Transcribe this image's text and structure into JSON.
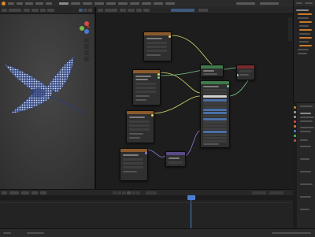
{
  "app": {
    "name": "",
    "scene": "",
    "view_layer": ""
  },
  "topbar": {
    "menus": [
      "",
      "",
      "",
      "",
      "",
      "",
      "",
      "",
      "",
      ""
    ],
    "workspace_tabs": [
      "",
      "",
      "",
      ""
    ]
  },
  "viewport": {
    "mode": "",
    "header_items": [
      "",
      "",
      "",
      ""
    ]
  },
  "node_editor": {
    "material": "",
    "header_items": [
      "",
      "",
      "",
      "",
      ""
    ],
    "nodes": [
      {
        "title": "",
        "header_color": "#8a5a2b"
      },
      {
        "title": "",
        "header_color": "#8a5a2b"
      },
      {
        "title": "",
        "header_color": "#8a5a2b"
      },
      {
        "title": "",
        "header_color": "#8a5a2b"
      },
      {
        "title": "",
        "header_color": "#5a4a8a"
      },
      {
        "title": "",
        "header_color": "#3e7a4a"
      },
      {
        "title": "",
        "header_color": "#3e7a4a"
      },
      {
        "title": "",
        "header_color": "#7a2a2a"
      }
    ]
  },
  "outliner": {
    "items": [
      "",
      "",
      "",
      "",
      "",
      "",
      "",
      "",
      "",
      ""
    ]
  },
  "properties": {
    "rows": [
      "",
      "",
      "",
      "",
      "",
      "",
      "",
      "",
      "",
      "",
      "",
      ""
    ]
  },
  "timeline": {
    "current_frame": "",
    "start": "",
    "end": "",
    "ticks": [
      "",
      "",
      "",
      "",
      "",
      "",
      "",
      "",
      "",
      "",
      "",
      ""
    ]
  },
  "statusbar": {
    "left": "",
    "right": ""
  },
  "colors": {
    "accent": "#4a6fa5",
    "playhead": "#4a7fd0",
    "link_yellow": "#d8d86a",
    "link_green": "#7cc88a",
    "link_purple": "#8a7cd8",
    "node_shader": "#3e7a4a",
    "node_texture": "#8a5a2b",
    "node_output": "#7a2a2a"
  }
}
